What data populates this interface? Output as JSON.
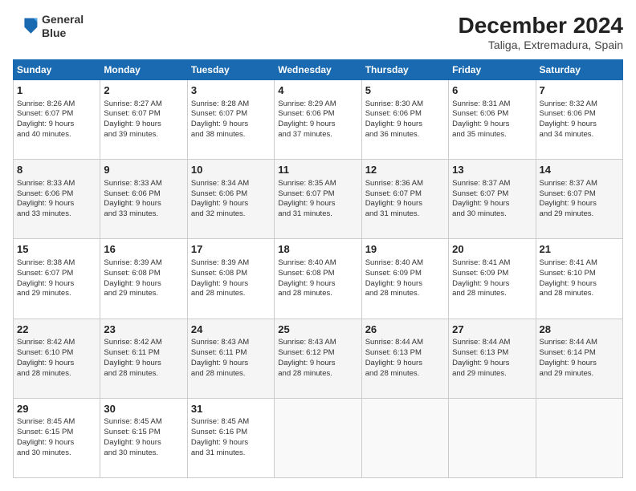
{
  "header": {
    "logo_line1": "General",
    "logo_line2": "Blue",
    "month_title": "December 2024",
    "location": "Taliga, Extremadura, Spain"
  },
  "weekdays": [
    "Sunday",
    "Monday",
    "Tuesday",
    "Wednesday",
    "Thursday",
    "Friday",
    "Saturday"
  ],
  "weeks": [
    [
      {
        "day": "1",
        "lines": [
          "Sunrise: 8:26 AM",
          "Sunset: 6:07 PM",
          "Daylight: 9 hours",
          "and 40 minutes."
        ]
      },
      {
        "day": "2",
        "lines": [
          "Sunrise: 8:27 AM",
          "Sunset: 6:07 PM",
          "Daylight: 9 hours",
          "and 39 minutes."
        ]
      },
      {
        "day": "3",
        "lines": [
          "Sunrise: 8:28 AM",
          "Sunset: 6:07 PM",
          "Daylight: 9 hours",
          "and 38 minutes."
        ]
      },
      {
        "day": "4",
        "lines": [
          "Sunrise: 8:29 AM",
          "Sunset: 6:06 PM",
          "Daylight: 9 hours",
          "and 37 minutes."
        ]
      },
      {
        "day": "5",
        "lines": [
          "Sunrise: 8:30 AM",
          "Sunset: 6:06 PM",
          "Daylight: 9 hours",
          "and 36 minutes."
        ]
      },
      {
        "day": "6",
        "lines": [
          "Sunrise: 8:31 AM",
          "Sunset: 6:06 PM",
          "Daylight: 9 hours",
          "and 35 minutes."
        ]
      },
      {
        "day": "7",
        "lines": [
          "Sunrise: 8:32 AM",
          "Sunset: 6:06 PM",
          "Daylight: 9 hours",
          "and 34 minutes."
        ]
      }
    ],
    [
      {
        "day": "8",
        "lines": [
          "Sunrise: 8:33 AM",
          "Sunset: 6:06 PM",
          "Daylight: 9 hours",
          "and 33 minutes."
        ]
      },
      {
        "day": "9",
        "lines": [
          "Sunrise: 8:33 AM",
          "Sunset: 6:06 PM",
          "Daylight: 9 hours",
          "and 33 minutes."
        ]
      },
      {
        "day": "10",
        "lines": [
          "Sunrise: 8:34 AM",
          "Sunset: 6:06 PM",
          "Daylight: 9 hours",
          "and 32 minutes."
        ]
      },
      {
        "day": "11",
        "lines": [
          "Sunrise: 8:35 AM",
          "Sunset: 6:07 PM",
          "Daylight: 9 hours",
          "and 31 minutes."
        ]
      },
      {
        "day": "12",
        "lines": [
          "Sunrise: 8:36 AM",
          "Sunset: 6:07 PM",
          "Daylight: 9 hours",
          "and 31 minutes."
        ]
      },
      {
        "day": "13",
        "lines": [
          "Sunrise: 8:37 AM",
          "Sunset: 6:07 PM",
          "Daylight: 9 hours",
          "and 30 minutes."
        ]
      },
      {
        "day": "14",
        "lines": [
          "Sunrise: 8:37 AM",
          "Sunset: 6:07 PM",
          "Daylight: 9 hours",
          "and 29 minutes."
        ]
      }
    ],
    [
      {
        "day": "15",
        "lines": [
          "Sunrise: 8:38 AM",
          "Sunset: 6:07 PM",
          "Daylight: 9 hours",
          "and 29 minutes."
        ]
      },
      {
        "day": "16",
        "lines": [
          "Sunrise: 8:39 AM",
          "Sunset: 6:08 PM",
          "Daylight: 9 hours",
          "and 29 minutes."
        ]
      },
      {
        "day": "17",
        "lines": [
          "Sunrise: 8:39 AM",
          "Sunset: 6:08 PM",
          "Daylight: 9 hours",
          "and 28 minutes."
        ]
      },
      {
        "day": "18",
        "lines": [
          "Sunrise: 8:40 AM",
          "Sunset: 6:08 PM",
          "Daylight: 9 hours",
          "and 28 minutes."
        ]
      },
      {
        "day": "19",
        "lines": [
          "Sunrise: 8:40 AM",
          "Sunset: 6:09 PM",
          "Daylight: 9 hours",
          "and 28 minutes."
        ]
      },
      {
        "day": "20",
        "lines": [
          "Sunrise: 8:41 AM",
          "Sunset: 6:09 PM",
          "Daylight: 9 hours",
          "and 28 minutes."
        ]
      },
      {
        "day": "21",
        "lines": [
          "Sunrise: 8:41 AM",
          "Sunset: 6:10 PM",
          "Daylight: 9 hours",
          "and 28 minutes."
        ]
      }
    ],
    [
      {
        "day": "22",
        "lines": [
          "Sunrise: 8:42 AM",
          "Sunset: 6:10 PM",
          "Daylight: 9 hours",
          "and 28 minutes."
        ]
      },
      {
        "day": "23",
        "lines": [
          "Sunrise: 8:42 AM",
          "Sunset: 6:11 PM",
          "Daylight: 9 hours",
          "and 28 minutes."
        ]
      },
      {
        "day": "24",
        "lines": [
          "Sunrise: 8:43 AM",
          "Sunset: 6:11 PM",
          "Daylight: 9 hours",
          "and 28 minutes."
        ]
      },
      {
        "day": "25",
        "lines": [
          "Sunrise: 8:43 AM",
          "Sunset: 6:12 PM",
          "Daylight: 9 hours",
          "and 28 minutes."
        ]
      },
      {
        "day": "26",
        "lines": [
          "Sunrise: 8:44 AM",
          "Sunset: 6:13 PM",
          "Daylight: 9 hours",
          "and 28 minutes."
        ]
      },
      {
        "day": "27",
        "lines": [
          "Sunrise: 8:44 AM",
          "Sunset: 6:13 PM",
          "Daylight: 9 hours",
          "and 29 minutes."
        ]
      },
      {
        "day": "28",
        "lines": [
          "Sunrise: 8:44 AM",
          "Sunset: 6:14 PM",
          "Daylight: 9 hours",
          "and 29 minutes."
        ]
      }
    ],
    [
      {
        "day": "29",
        "lines": [
          "Sunrise: 8:45 AM",
          "Sunset: 6:15 PM",
          "Daylight: 9 hours",
          "and 30 minutes."
        ]
      },
      {
        "day": "30",
        "lines": [
          "Sunrise: 8:45 AM",
          "Sunset: 6:15 PM",
          "Daylight: 9 hours",
          "and 30 minutes."
        ]
      },
      {
        "day": "31",
        "lines": [
          "Sunrise: 8:45 AM",
          "Sunset: 6:16 PM",
          "Daylight: 9 hours",
          "and 31 minutes."
        ]
      },
      null,
      null,
      null,
      null
    ]
  ]
}
